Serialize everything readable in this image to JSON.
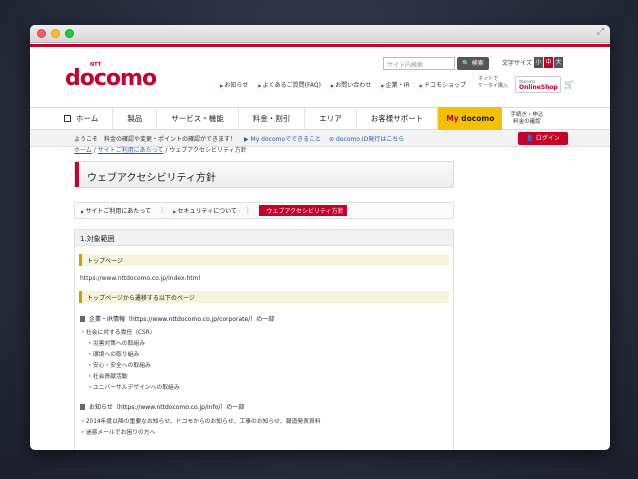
{
  "window": {
    "fullscreen_glyph": "⤢"
  },
  "header": {
    "logo_small": "NTT",
    "logo": "docomo",
    "search_placeholder": "サイト内検索",
    "search_button": "検索",
    "text_size_label": "文字サイズ",
    "size_small": "小",
    "size_medium": "中",
    "size_large": "大",
    "top_links": [
      "お知らせ",
      "よくあるご質問(FAQ)",
      "お問い合わせ",
      "企業・IR",
      "ドコモショップ"
    ],
    "keitai_line1": "ネットで",
    "keitai_line2": "ケータイ購入",
    "online_shop_small": "docomo",
    "online_shop": "OnlineShop",
    "cart_icon": "🛒"
  },
  "nav": {
    "items": [
      "ホーム",
      "製品",
      "サービス・機能",
      "料金・割引",
      "エリア",
      "お客様サポート"
    ],
    "mydocomo_prefix": "My",
    "mydocomo": "docomo",
    "procedures_line1": "手続き・申込",
    "procedures_line2": "料金の確認"
  },
  "subbar": {
    "welcome": "ようこそ　料金の確認や変更・ポイントの確認ができます！",
    "link1": "▶ My docomoでできること",
    "link2": "docomo ID発行はこちら",
    "login": "ログイン"
  },
  "breadcrumb": {
    "home": "ホーム",
    "site_use": "サイトご利用にあたって",
    "current": "ウェブアクセシビリティ方針"
  },
  "page_title": "ウェブアクセシビリティ方針",
  "tabs": [
    "サイトご利用にあたって",
    "セキュリティについて",
    "ウェブアクセシビリティ方針"
  ],
  "section": {
    "heading": "1.対象範囲",
    "bar1": "トップページ",
    "url1": "https://www.nttdocomo.co.jp/index.html",
    "bar2": "トップページから遷移する以下のページ",
    "sub1": "企業・IR情報（https://www.nttdocomo.co.jp/corporate/）の一部",
    "sub1_items": [
      "社会に対する責任（CSR）",
      "災害対策への取組み",
      "環境への取り組み",
      "安心・安全への取組み",
      "社会貢献活動",
      "ユニバーサルデザインへの取組み"
    ],
    "sub2": "お知らせ（https://www.nttdocomo.co.jp/info/）の一部",
    "sub2_items": [
      "2014年度以降の重要なお知らせ、ドコモからのお知らせ、工事のお知らせ、報道発表資料",
      "迷惑メールでお困りの方へ"
    ]
  }
}
